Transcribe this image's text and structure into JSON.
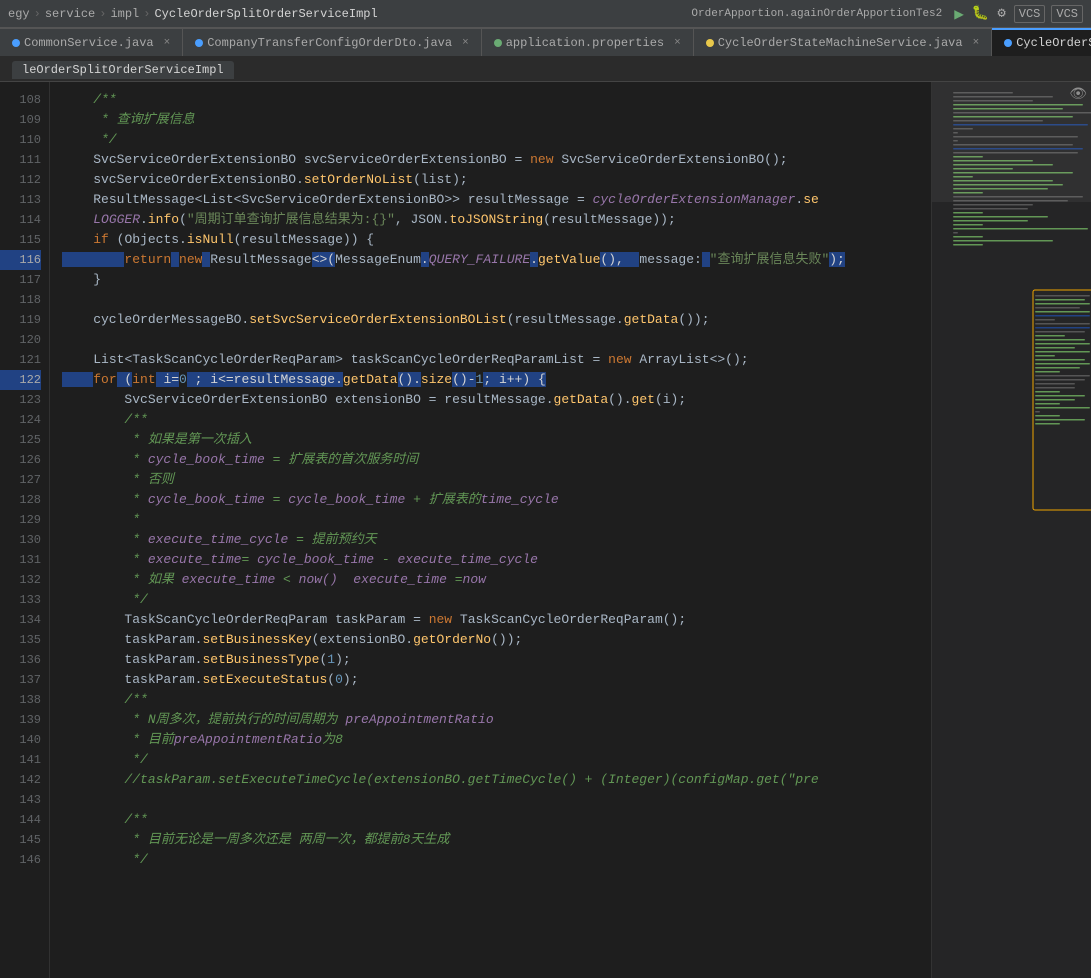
{
  "topbar": {
    "breadcrumb": [
      "egy",
      "service",
      "impl",
      "CycleOrderSplitOrderServiceImpl"
    ],
    "run_config": "OrderApportion.againOrderApportionTes2",
    "vcs1": "VCS",
    "vcs2": "VCS"
  },
  "tabs": [
    {
      "id": "tab1",
      "label": "CommonService.java",
      "dot": "none",
      "active": false
    },
    {
      "id": "tab2",
      "label": "CompanyTransferConfigOrderDto.java",
      "dot": "blue",
      "active": false
    },
    {
      "id": "tab3",
      "label": "application.properties",
      "dot": "green",
      "active": false
    },
    {
      "id": "tab4",
      "label": "CycleOrderStateMachineService.java",
      "dot": "yellow",
      "active": false
    },
    {
      "id": "tab5",
      "label": "CycleOrderSplitOrderServiceImpl.ja",
      "dot": "blue",
      "active": true
    }
  ],
  "active_file": "leOrderSplitOrderServiceImpl",
  "lines": {
    "start": 1,
    "count": 50
  },
  "code_lines": [
    {
      "num": "108",
      "content": "    /**"
    },
    {
      "num": "109",
      "content": "     * 查询扩展信息"
    },
    {
      "num": "110",
      "content": "     */"
    },
    {
      "num": "111",
      "content": "    SvcServiceOrderExtensionBO svcServiceOrderExtensionBO = new SvcServiceOrderExtensionBO();"
    },
    {
      "num": "112",
      "content": "    svcServiceOrderExtensionBO.setOrderNoList(list);"
    },
    {
      "num": "113",
      "content": "    ResultMessage<List<SvcServiceOrderExtensionBO>> resultMessage = cycleOrderExtensionManager.se"
    },
    {
      "num": "114",
      "content": "    LOGGER.info(\"周期订单查询扩展信息结果为:{}\", JSON.toJSONString(resultMessage));"
    },
    {
      "num": "115",
      "content": "    if (Objects.isNull(resultMessage)) {"
    },
    {
      "num": "116",
      "content": "        return new ResultMessage<>(MessageEnum.QUERY_FAILURE.getValue(),  message: \"查询扩展信息失败\");"
    },
    {
      "num": "117",
      "content": "    }"
    },
    {
      "num": "118",
      "content": ""
    },
    {
      "num": "119",
      "content": "    cycleOrderMessageBO.setSvcServiceOrderExtensionBOList(resultMessage.getData());"
    },
    {
      "num": "120",
      "content": ""
    },
    {
      "num": "121",
      "content": "    List<TaskScanCycleOrderReqParam> taskScanCycleOrderReqParamList = new ArrayList<>();"
    },
    {
      "num": "122",
      "content": "    for (int i=0 ; i<=resultMessage.getData().size()-1; i++) {"
    },
    {
      "num": "123",
      "content": "        SvcServiceOrderExtensionBO extensionBO = resultMessage.getData().get(i);"
    },
    {
      "num": "124",
      "content": "        /**"
    },
    {
      "num": "125",
      "content": "         * 如果是第一次插入"
    },
    {
      "num": "126",
      "content": "         * cycle_book_time = 扩展表的首次服务时间"
    },
    {
      "num": "127",
      "content": "         * 否则"
    },
    {
      "num": "128",
      "content": "         * cycle_book_time = cycle_book_time + 扩展表的time_cycle"
    },
    {
      "num": "129",
      "content": "         *"
    },
    {
      "num": "130",
      "content": "         * execute_time_cycle = 提前预约天"
    },
    {
      "num": "131",
      "content": "         * execute_time= cycle_book_time - execute_time_cycle"
    },
    {
      "num": "132",
      "content": "         * 如果 execute_time < now()  execute_time =now"
    },
    {
      "num": "133",
      "content": "         */"
    },
    {
      "num": "134",
      "content": "        TaskScanCycleOrderReqParam taskParam = new TaskScanCycleOrderReqParam();"
    },
    {
      "num": "135",
      "content": "        taskParam.setBusinessKey(extensionBO.getOrderNo());"
    },
    {
      "num": "136",
      "content": "        taskParam.setBusinessType(1);"
    },
    {
      "num": "137",
      "content": "        taskParam.setExecuteStatus(0);"
    },
    {
      "num": "138",
      "content": "        /**"
    },
    {
      "num": "139",
      "content": "         * N周多次，提前执行的时间周期为 preAppointmentRatio"
    },
    {
      "num": "140",
      "content": "         * 目前preAppointmentRatio为8"
    },
    {
      "num": "141",
      "content": "         */"
    },
    {
      "num": "142",
      "content": "        //taskParam.setExecuteTimeCycle(extensionBO.getTimeCycle() + (Integer)(configMap.get(\"pre"
    },
    {
      "num": "143",
      "content": ""
    },
    {
      "num": "144",
      "content": "        /**"
    },
    {
      "num": "145",
      "content": "         * 目前无论是一周多次还是 两周一次，都提前8天生成"
    },
    {
      "num": "146",
      "content": "         */"
    }
  ]
}
